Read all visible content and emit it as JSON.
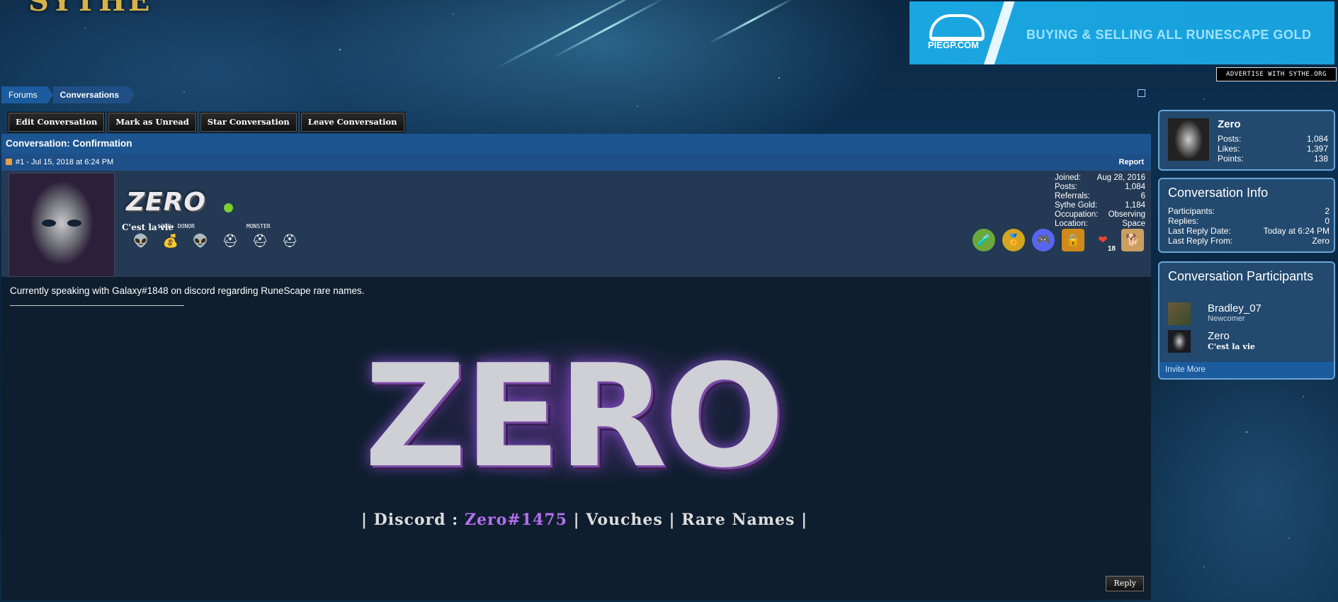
{
  "site": {
    "logo_text": "SYTHE"
  },
  "ad": {
    "brand": "PIEGP.COM",
    "tagline": "BUYING & SELLING ALL RUNESCAPE GOLD",
    "advertise_label": "ADVERTISE WITH SYTHE.ORG"
  },
  "breadcrumb": [
    "Forums",
    "Conversations"
  ],
  "toolbar": {
    "edit_label": "Edit Conversation",
    "unread_label": "Mark as Unread",
    "star_label": "Star Conversation",
    "leave_label": "Leave Conversation"
  },
  "conversation": {
    "title": "Conversation: Confirmation"
  },
  "post": {
    "meta": "#1 - Jul 15, 2018 at 6:24 PM",
    "report_label": "Report",
    "username": "ZERO",
    "user_title": "C'est la vie",
    "badges": {
      "label_1": "$300+ DONOR",
      "label_2": "MONSTER"
    },
    "stats": [
      {
        "k": "Joined:",
        "v": "Aug 28, 2016"
      },
      {
        "k": "Posts:",
        "v": "1,084"
      },
      {
        "k": "Referrals:",
        "v": "6"
      },
      {
        "k": "Sythe Gold:",
        "v": "1,184"
      },
      {
        "k": "Occupation:",
        "v": "Observing"
      },
      {
        "k": "Location:",
        "v": "Space"
      }
    ],
    "heart_count": "18",
    "message": "Currently speaking with Galaxy#1848 on discord regarding RuneScape rare names.",
    "signature": {
      "big": "ZERO",
      "discord_label": "| Discord : ",
      "discord_handle": "Zero#1475",
      "rest": " | Vouches | Rare Names |"
    },
    "reply_label": "Reply"
  },
  "sidebar": {
    "profile": {
      "name": "Zero",
      "stats": [
        {
          "k": "Posts:",
          "v": "1,084"
        },
        {
          "k": "Likes:",
          "v": "1,397"
        },
        {
          "k": "Points:",
          "v": "138"
        }
      ]
    },
    "info": {
      "title": "Conversation Info",
      "rows": [
        {
          "k": "Participants:",
          "v": "2"
        },
        {
          "k": "Replies:",
          "v": "0"
        },
        {
          "k": "Last Reply Date:",
          "v": "Today at 6:24 PM"
        },
        {
          "k": "Last Reply From:",
          "v": "Zero"
        }
      ]
    },
    "participants": {
      "title": "Conversation Participants",
      "list": [
        {
          "name": "Bradley_07",
          "title": "Newcomer"
        },
        {
          "name": "Zero",
          "title": "C'est la vie"
        }
      ],
      "invite_label": "Invite More"
    }
  }
}
